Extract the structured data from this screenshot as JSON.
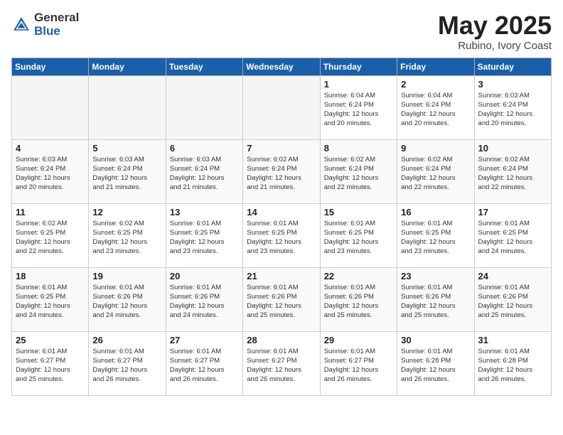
{
  "header": {
    "logo_general": "General",
    "logo_blue": "Blue",
    "title": "May 2025",
    "subtitle": "Rubino, Ivory Coast"
  },
  "weekdays": [
    "Sunday",
    "Monday",
    "Tuesday",
    "Wednesday",
    "Thursday",
    "Friday",
    "Saturday"
  ],
  "weeks": [
    [
      {
        "day": "",
        "info": ""
      },
      {
        "day": "",
        "info": ""
      },
      {
        "day": "",
        "info": ""
      },
      {
        "day": "",
        "info": ""
      },
      {
        "day": "1",
        "info": "Sunrise: 6:04 AM\nSunset: 6:24 PM\nDaylight: 12 hours\nand 20 minutes."
      },
      {
        "day": "2",
        "info": "Sunrise: 6:04 AM\nSunset: 6:24 PM\nDaylight: 12 hours\nand 20 minutes."
      },
      {
        "day": "3",
        "info": "Sunrise: 6:03 AM\nSunset: 6:24 PM\nDaylight: 12 hours\nand 20 minutes."
      }
    ],
    [
      {
        "day": "4",
        "info": "Sunrise: 6:03 AM\nSunset: 6:24 PM\nDaylight: 12 hours\nand 20 minutes."
      },
      {
        "day": "5",
        "info": "Sunrise: 6:03 AM\nSunset: 6:24 PM\nDaylight: 12 hours\nand 21 minutes."
      },
      {
        "day": "6",
        "info": "Sunrise: 6:03 AM\nSunset: 6:24 PM\nDaylight: 12 hours\nand 21 minutes."
      },
      {
        "day": "7",
        "info": "Sunrise: 6:02 AM\nSunset: 6:24 PM\nDaylight: 12 hours\nand 21 minutes."
      },
      {
        "day": "8",
        "info": "Sunrise: 6:02 AM\nSunset: 6:24 PM\nDaylight: 12 hours\nand 22 minutes."
      },
      {
        "day": "9",
        "info": "Sunrise: 6:02 AM\nSunset: 6:24 PM\nDaylight: 12 hours\nand 22 minutes."
      },
      {
        "day": "10",
        "info": "Sunrise: 6:02 AM\nSunset: 6:24 PM\nDaylight: 12 hours\nand 22 minutes."
      }
    ],
    [
      {
        "day": "11",
        "info": "Sunrise: 6:02 AM\nSunset: 6:25 PM\nDaylight: 12 hours\nand 22 minutes."
      },
      {
        "day": "12",
        "info": "Sunrise: 6:02 AM\nSunset: 6:25 PM\nDaylight: 12 hours\nand 23 minutes."
      },
      {
        "day": "13",
        "info": "Sunrise: 6:01 AM\nSunset: 6:25 PM\nDaylight: 12 hours\nand 23 minutes."
      },
      {
        "day": "14",
        "info": "Sunrise: 6:01 AM\nSunset: 6:25 PM\nDaylight: 12 hours\nand 23 minutes."
      },
      {
        "day": "15",
        "info": "Sunrise: 6:01 AM\nSunset: 6:25 PM\nDaylight: 12 hours\nand 23 minutes."
      },
      {
        "day": "16",
        "info": "Sunrise: 6:01 AM\nSunset: 6:25 PM\nDaylight: 12 hours\nand 23 minutes."
      },
      {
        "day": "17",
        "info": "Sunrise: 6:01 AM\nSunset: 6:25 PM\nDaylight: 12 hours\nand 24 minutes."
      }
    ],
    [
      {
        "day": "18",
        "info": "Sunrise: 6:01 AM\nSunset: 6:25 PM\nDaylight: 12 hours\nand 24 minutes."
      },
      {
        "day": "19",
        "info": "Sunrise: 6:01 AM\nSunset: 6:26 PM\nDaylight: 12 hours\nand 24 minutes."
      },
      {
        "day": "20",
        "info": "Sunrise: 6:01 AM\nSunset: 6:26 PM\nDaylight: 12 hours\nand 24 minutes."
      },
      {
        "day": "21",
        "info": "Sunrise: 6:01 AM\nSunset: 6:26 PM\nDaylight: 12 hours\nand 25 minutes."
      },
      {
        "day": "22",
        "info": "Sunrise: 6:01 AM\nSunset: 6:26 PM\nDaylight: 12 hours\nand 25 minutes."
      },
      {
        "day": "23",
        "info": "Sunrise: 6:01 AM\nSunset: 6:26 PM\nDaylight: 12 hours\nand 25 minutes."
      },
      {
        "day": "24",
        "info": "Sunrise: 6:01 AM\nSunset: 6:26 PM\nDaylight: 12 hours\nand 25 minutes."
      }
    ],
    [
      {
        "day": "25",
        "info": "Sunrise: 6:01 AM\nSunset: 6:27 PM\nDaylight: 12 hours\nand 25 minutes."
      },
      {
        "day": "26",
        "info": "Sunrise: 6:01 AM\nSunset: 6:27 PM\nDaylight: 12 hours\nand 26 minutes."
      },
      {
        "day": "27",
        "info": "Sunrise: 6:01 AM\nSunset: 6:27 PM\nDaylight: 12 hours\nand 26 minutes."
      },
      {
        "day": "28",
        "info": "Sunrise: 6:01 AM\nSunset: 6:27 PM\nDaylight: 12 hours\nand 26 minutes."
      },
      {
        "day": "29",
        "info": "Sunrise: 6:01 AM\nSunset: 6:27 PM\nDaylight: 12 hours\nand 26 minutes."
      },
      {
        "day": "30",
        "info": "Sunrise: 6:01 AM\nSunset: 6:28 PM\nDaylight: 12 hours\nand 26 minutes."
      },
      {
        "day": "31",
        "info": "Sunrise: 6:01 AM\nSunset: 6:28 PM\nDaylight: 12 hours\nand 26 minutes."
      }
    ]
  ]
}
